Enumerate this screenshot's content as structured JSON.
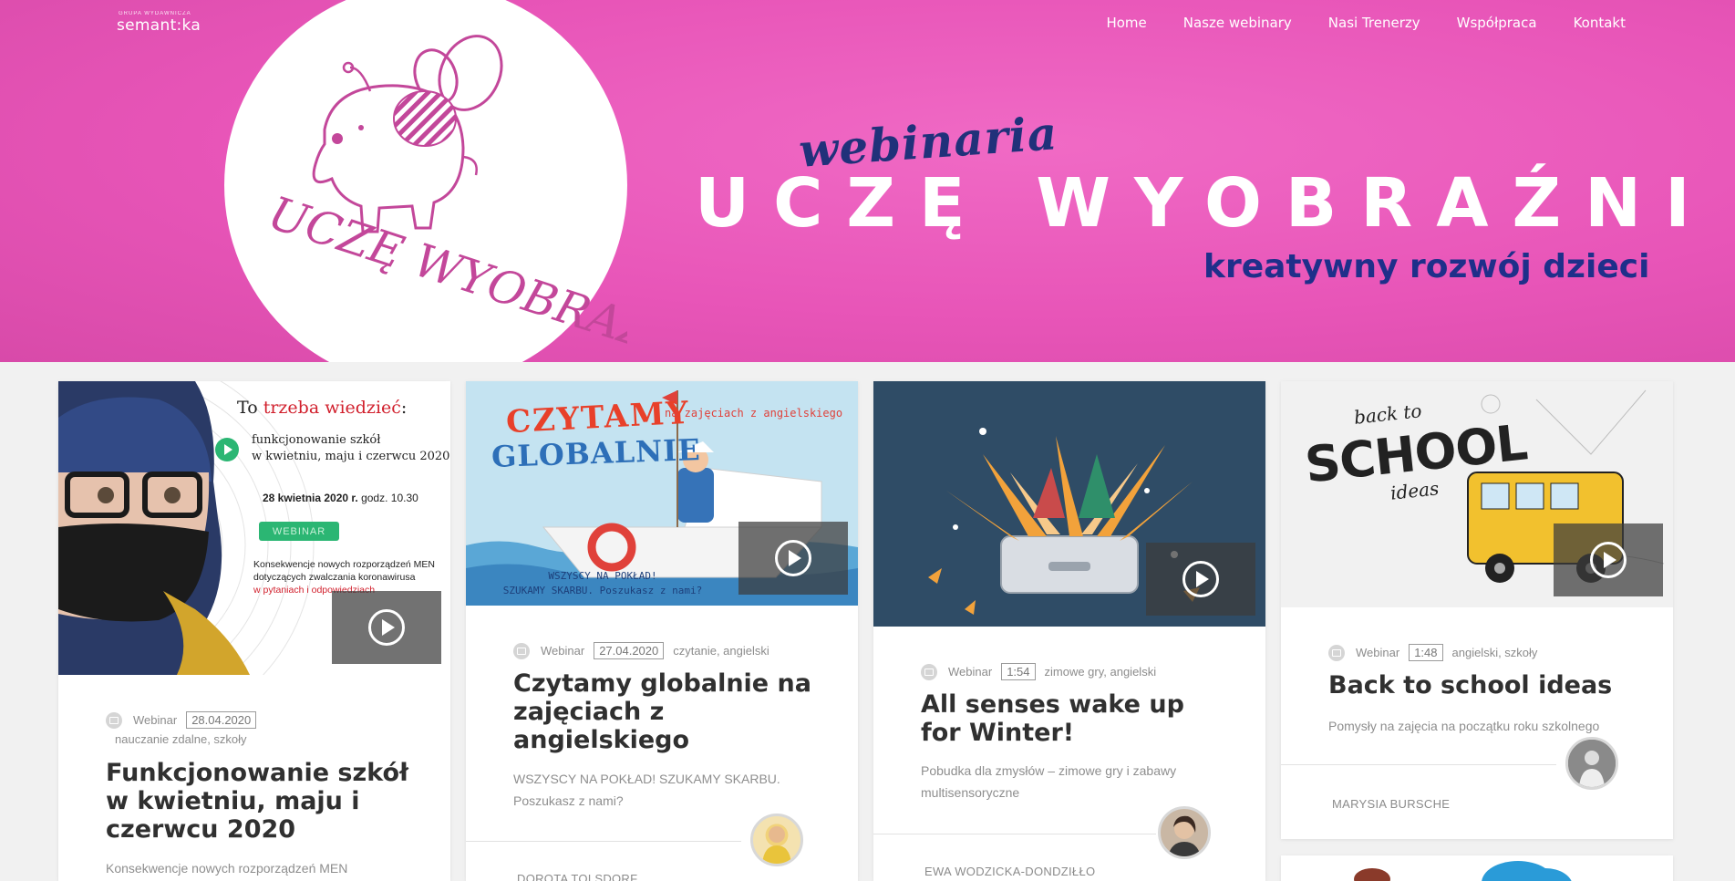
{
  "brand": {
    "small": "GRUPA WYDAWNICZA",
    "name": "semant:ka"
  },
  "nav": [
    "Home",
    "Nasze webinary",
    "Nasi Trenerzy",
    "Współpraca",
    "Kontakt"
  ],
  "hero": {
    "logo_text": "UCZĘ WYOBRAŹNI!",
    "script_word": "webinaria",
    "title": "UCZĘ WYOBRAŹNI",
    "subtitle": "kreatywny rozwój dzieci",
    "colors": {
      "background": "#e855b8",
      "accent": "#21317a"
    }
  },
  "cards": [
    {
      "thumb": {
        "heading_plain": "To ",
        "heading_red": "trzeba wiedzieć",
        "heading_colon": ":",
        "line1": "funkcjonowanie szkół",
        "line2": "w kwietniu, maju i czerwcu 2020",
        "date_bold": "28 kwietnia 2020 r.",
        "date_rest": " godz. 10.30",
        "badge": "WEBINAR",
        "note1": "Konsekwencje nowych rozporządzeń MEN",
        "note2": "dotyczących zwalczania koronawirusa",
        "note3": "w pytaniach i odpowiedziach"
      },
      "type": "Webinar",
      "date": "28.04.2020",
      "tags": "nauczanie zdalne, szkoły",
      "title": "Funkcjonowanie szkół w kwietniu, maju i czerwcu 2020",
      "description": "Konsekwencje nowych rozporządzeń MEN"
    },
    {
      "thumb": {
        "word1": "CZYTAMY",
        "word2": "GLOBALNIE",
        "aside": "na zajęciach z angielskiego",
        "caption1": "WSZYSCY NA POKŁAD!",
        "caption2": "SZUKAMY SKARBU. Poszukasz z nami?"
      },
      "type": "Webinar",
      "date": "27.04.2020",
      "tags": "czytanie, angielski",
      "title": "Czytamy globalnie na zajęciach z angielskiego",
      "description": "WSZYSCY NA POKŁAD! SZUKAMY SKARBU. Poszukasz z nami?",
      "author": "DOROTA TOLSDORF"
    },
    {
      "type": "Webinar",
      "date": "1:54",
      "tags": "zimowe gry, angielski",
      "title": "All senses wake up for Winter!",
      "description": "Pobudka dla zmysłów – zimowe gry i zabawy multisensoryczne",
      "author": "EWA WODZICKA-DONDZIŁŁO"
    },
    {
      "thumb": {
        "small1": "back to",
        "big": "SCHOOL",
        "small2": "ideas"
      },
      "type": "Webinar",
      "date": "1:48",
      "tags": "angielski, szkoły",
      "title": "Back to school ideas",
      "description": "Pomysły na zajęcia na początku roku szkolnego",
      "author": "MARYSIA BURSCHE"
    }
  ]
}
